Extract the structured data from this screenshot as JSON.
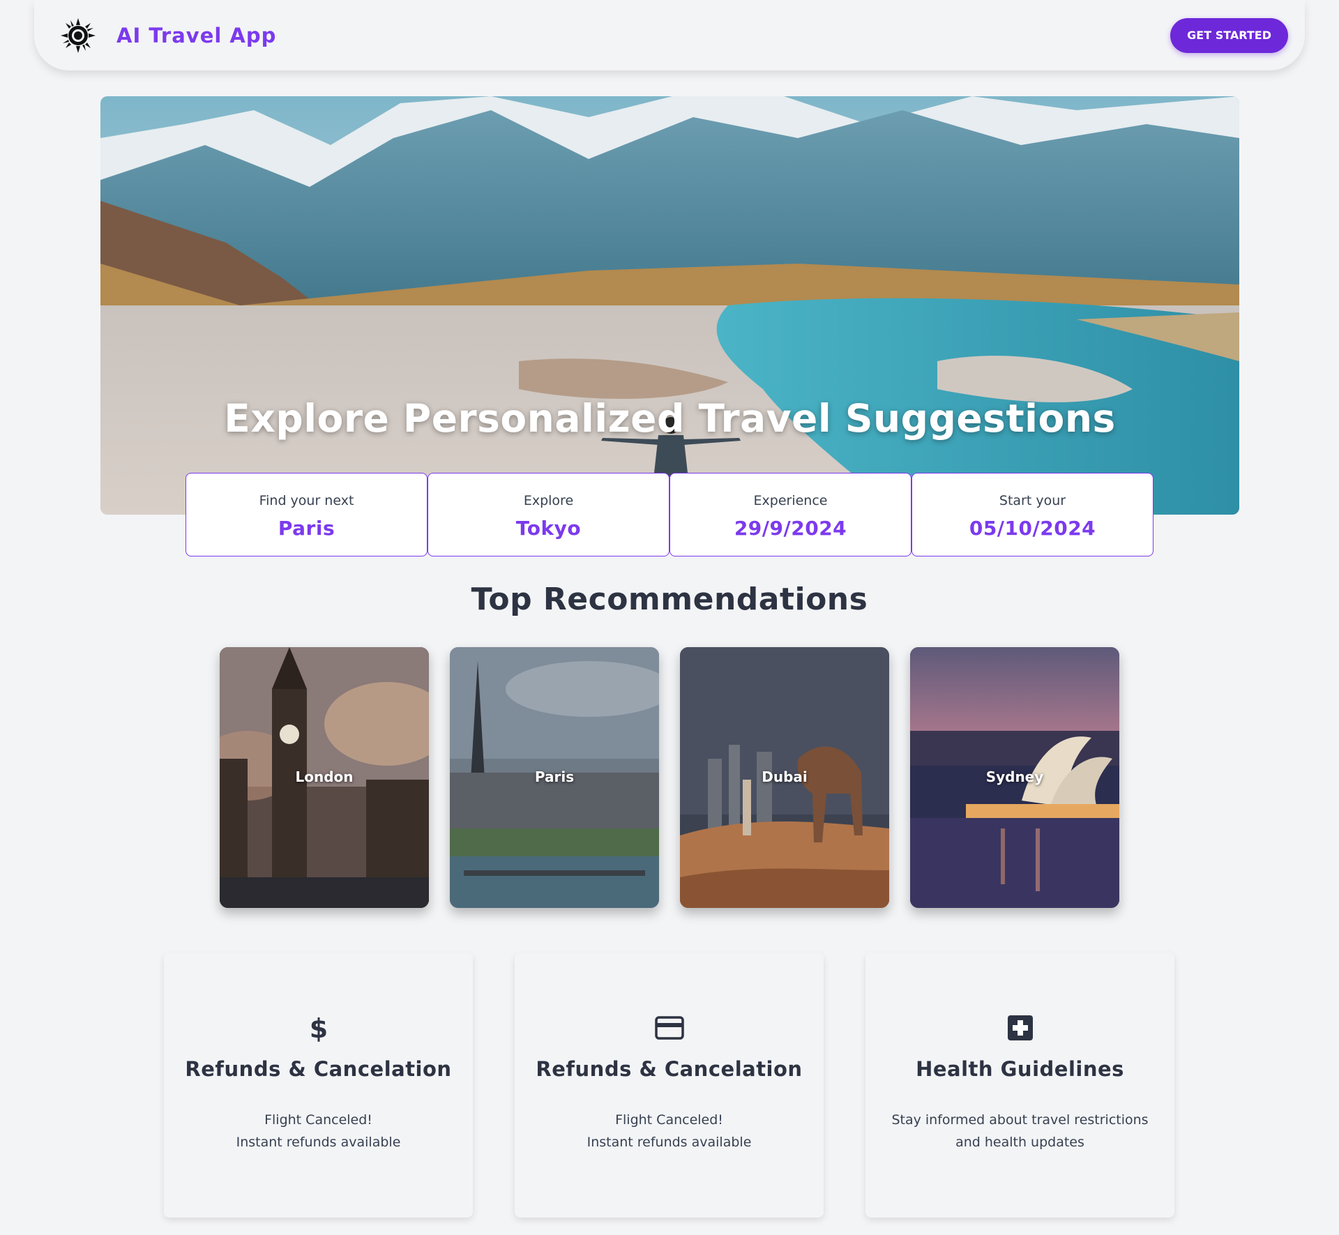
{
  "header": {
    "brand_name": "AI Travel App",
    "cta_label": "GET STARTED",
    "logo_icon": "sun-eclipse-icon"
  },
  "hero": {
    "title": "Explore Personalized Travel Suggestions",
    "image": "mountain-river-traveler-photo"
  },
  "info_boxes": [
    {
      "label": "Find your next",
      "value": "Paris"
    },
    {
      "label": "Explore",
      "value": "Tokyo"
    },
    {
      "label": "Experience",
      "value": "29/9/2024"
    },
    {
      "label": "Start your",
      "value": "05/10/2024"
    }
  ],
  "recommendations": {
    "title": "Top Recommendations",
    "cards": [
      {
        "name": "London",
        "image": "big-ben-photo"
      },
      {
        "name": "Paris",
        "image": "eiffel-tower-photo"
      },
      {
        "name": "Dubai",
        "image": "desert-camel-photo"
      },
      {
        "name": "Sydney",
        "image": "opera-house-photo"
      }
    ]
  },
  "features": [
    {
      "icon": "dollar-icon",
      "title": "Refunds & Cancelation",
      "desc_line1": "Flight Canceled!",
      "desc_line2": "Instant refunds available"
    },
    {
      "icon": "credit-card-icon",
      "title": "Refunds & Cancelation",
      "desc_line1": "Flight Canceled!",
      "desc_line2": "Instant refunds available"
    },
    {
      "icon": "medical-plus-icon",
      "title": "Health Guidelines",
      "desc_line1": "Stay informed about travel restrictions",
      "desc_line2": "and health updates"
    }
  ],
  "colors": {
    "accent": "#7c3aed",
    "button": "#6d28d9",
    "background": "#f3f4f6",
    "heading": "#2d3342"
  }
}
